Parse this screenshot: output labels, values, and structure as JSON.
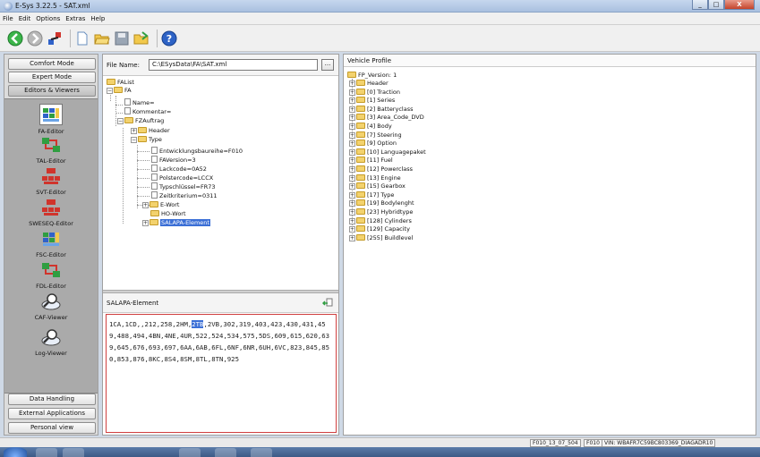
{
  "window": {
    "title": "E-Sys 3.22.5 - SAT.xml",
    "min": "_",
    "max": "□",
    "close": "X"
  },
  "menu": [
    "File",
    "Edit",
    "Options",
    "Extras",
    "Help"
  ],
  "toolbar": {
    "icons": [
      "back-icon",
      "forward-icon",
      "connect-icon",
      "new-file-icon",
      "open-folder-icon",
      "save-icon",
      "open-icon",
      "help-icon"
    ]
  },
  "left": {
    "top_buttons": [
      "Comfort Mode",
      "Expert Mode",
      "Editors & Viewers"
    ],
    "tools": [
      "FA-Editor",
      "TAL-Editor",
      "SVT-Editor",
      "SWESEQ-Editor",
      "FSC-Editor",
      "FDL-Editor",
      "CAF-Viewer",
      "Log-Viewer"
    ],
    "bottom_buttons": [
      "Data Handling",
      "External Applications",
      "Personal view"
    ]
  },
  "file": {
    "label": "File Name:",
    "value": "C:\\ESysData\\FA\\SAT.xml",
    "browse": "..."
  },
  "tree": [
    "FAList",
    "FA",
    "Name=",
    "Kommentar=",
    "FZAuftrag",
    "Header",
    "Type",
    "Entwicklungsbaureihe=F010",
    "FAVersion=3",
    "Lackcode=0A52",
    "Polstercode=LCCX",
    "Typschlüssel=FR73",
    "Zeitkriterium=0311",
    "E-Wort",
    "HO-Wort",
    "SALAPA-Element"
  ],
  "salapa": {
    "title": "SALAPA-Element",
    "before": "1CA,1CD,,212,258,2HM,",
    "highlight": "2TB",
    "after": ",2VB,302,319,403,423,430,431,459,488,494,4BN,4NE,4UR,522,524,534,575,5DS,609,615,620,639,645,676,693,697,6AA,6AB,6FL,6NF,6NR,6UH,6VC,823,845,850,853,876,8KC,8S4,8SM,8TL,8TN,925"
  },
  "profile": {
    "title": "Vehicle Profile",
    "root": "FP_Version: 1",
    "items": [
      "Header",
      "[0] Traction",
      "[1] Series",
      "[2] Batteryclass",
      "[3] Area_Code_DVD",
      "[4] Body",
      "[7] Steering",
      "[9] Option",
      "[10] Languagepaket",
      "[11] Fuel",
      "[12] Powerclass",
      "[13] Engine",
      "[15] Gearbox",
      "[17] Type",
      "[19] Bodylenght",
      "[23] Hybridtype",
      "[128] Cylinders",
      "[129] Capacity",
      "[255] Buildlevel"
    ]
  },
  "status": {
    "a": "F010_13_07_504",
    "b": "F010",
    "c": "VIN: WBAFR7C59BC803369_DIAGADR10"
  }
}
